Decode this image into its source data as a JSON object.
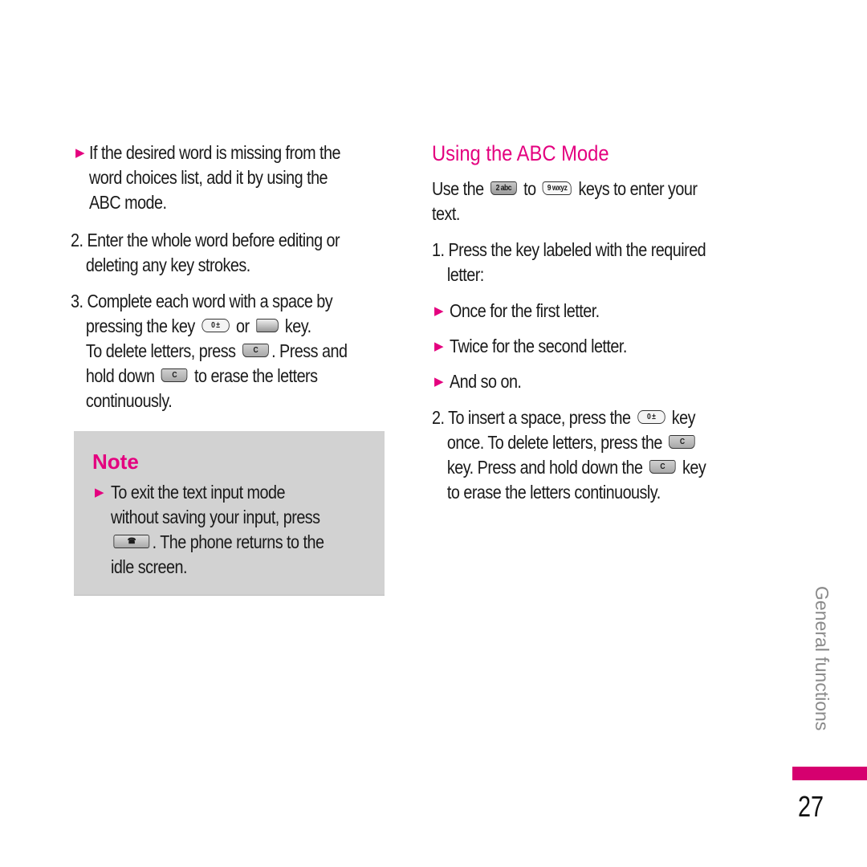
{
  "left": {
    "bullet1": [
      "If the desired word is missing from the",
      "word choices list, add it by using the",
      "ABC mode."
    ],
    "item2": [
      "2. Enter the whole word before editing or",
      "deleting any key strokes."
    ],
    "item3": {
      "l1": "3. Complete each word with a space by",
      "l2a": "pressing the key",
      "l2b": "or",
      "l2c": "key.",
      "l3a": "To delete letters, press",
      "l3b": ". Press and",
      "l4a": "hold down",
      "l4b": "to erase the letters",
      "l5": "continuously."
    }
  },
  "note": {
    "title": "Note",
    "l1": "To exit the text input mode",
    "l2": "without saving your input, press",
    "l3": ". The phone returns to the",
    "l4": "idle screen."
  },
  "right": {
    "heading": "Using the ABC Mode",
    "intro_a": "Use the",
    "intro_b": "to",
    "intro_c": "keys to enter your",
    "intro_d": "text.",
    "item1": [
      "1. Press the key labeled with the required",
      "letter:"
    ],
    "bullets": [
      "Once for the first letter.",
      "Twice for the second letter.",
      "And so on."
    ],
    "item2": {
      "l1a": "2. To insert a space, press the",
      "l1b": "key",
      "l2": "once. To delete letters, press the",
      "l3a": "key. Press and hold down the",
      "l3b": "key",
      "l4": "to erase the letters continuously."
    }
  },
  "keys": {
    "zero": "0 ±",
    "c": "C",
    "two": "2 abc",
    "nine": "9 wxyz",
    "end": "☎"
  },
  "sidebar": {
    "section": "General functions",
    "page": "27"
  },
  "colors": {
    "accent": "#e4007f",
    "note_bg": "#d2d2d2"
  }
}
